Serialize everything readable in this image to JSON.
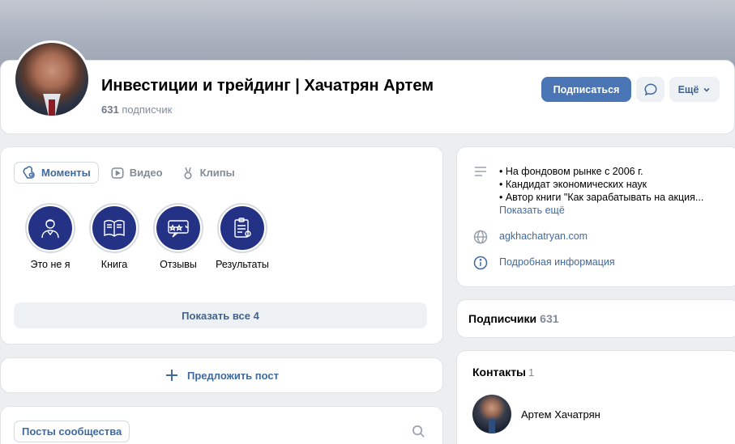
{
  "header": {
    "title": "Инвестиции и трейдинг | Хачатрян Артем",
    "subscribers_count": "631",
    "subscribers_label": "подписчик",
    "subscribe_label": "Подписаться",
    "more_label": "Ещё"
  },
  "tabs": [
    {
      "label": "Моменты",
      "icon": "moments-icon",
      "active": true
    },
    {
      "label": "Видео",
      "icon": "video-icon",
      "active": false
    },
    {
      "label": "Клипы",
      "icon": "clips-icon",
      "active": false
    }
  ],
  "stories": [
    {
      "label": "Это не я",
      "icon": "person-icon"
    },
    {
      "label": "Книга",
      "icon": "book-icon"
    },
    {
      "label": "Отзывы",
      "icon": "reviews-icon"
    },
    {
      "label": "Результаты",
      "icon": "results-icon"
    }
  ],
  "show_all_label": "Показать все 4",
  "suggest_post_label": "Предложить пост",
  "posts_tab_label": "Посты сообщества",
  "info": {
    "description_lines": [
      "• На фондовом рынке с 2006 г.",
      "• Кандидат экономических наук",
      "• Автор книги \"Как зарабатывать на акция..."
    ],
    "show_more_label": "Показать ещё",
    "website": "agkhachatryan.com",
    "details_label": "Подробная информация"
  },
  "subscribers_block": {
    "label": "Подписчики",
    "count": "631"
  },
  "contacts": {
    "label": "Контакты",
    "count": "1",
    "items": [
      {
        "name": "Артем Хачатрян"
      }
    ]
  },
  "colors": {
    "accent": "#4b76b5",
    "link": "#3f6aa0",
    "story_bg": "#233285",
    "page_bg": "#edeef0"
  }
}
